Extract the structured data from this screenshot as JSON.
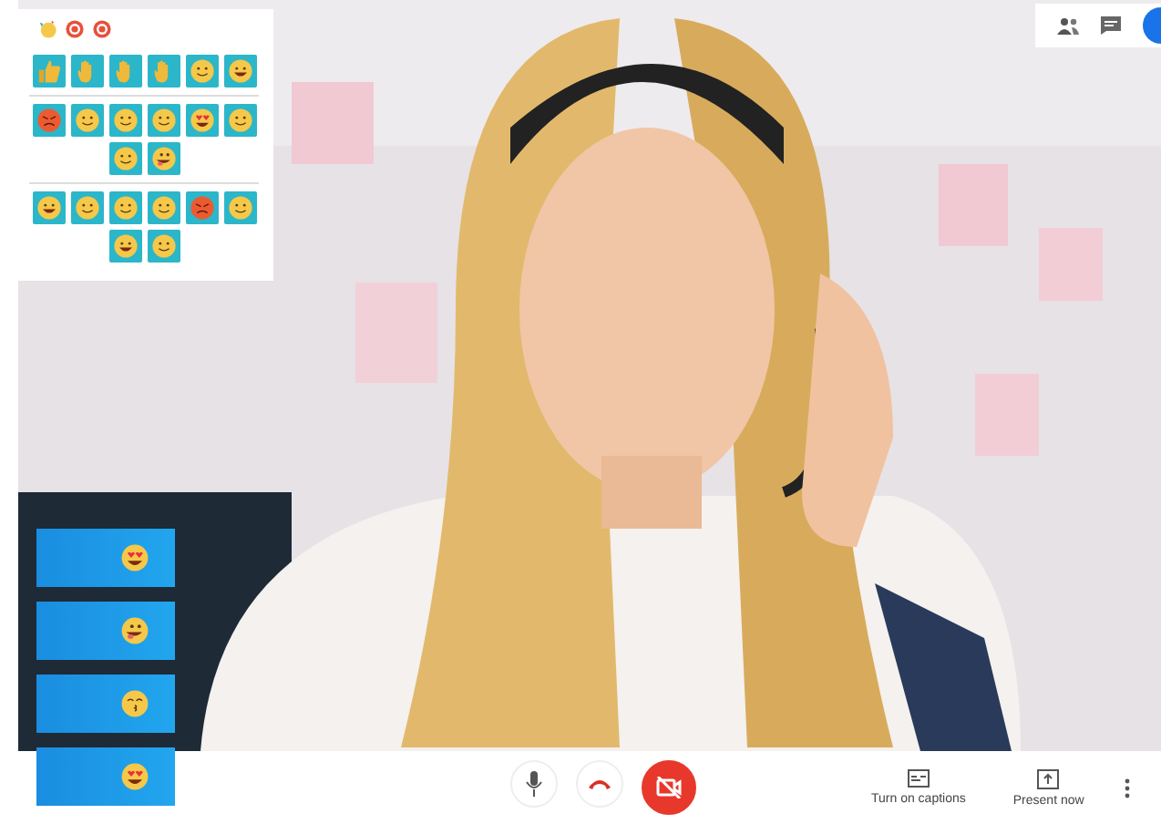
{
  "emoji_panel": {
    "header": [
      {
        "kind": "party"
      },
      {
        "kind": "ring"
      },
      {
        "kind": "ring"
      }
    ],
    "groups": [
      {
        "tiles": [
          {
            "kind": "thumb"
          },
          {
            "kind": "hand"
          },
          {
            "kind": "hand"
          },
          {
            "kind": "hand"
          },
          {
            "kind": "smile"
          },
          {
            "kind": "grin"
          }
        ]
      },
      {
        "tiles": [
          {
            "kind": "angry"
          },
          {
            "kind": "smile"
          },
          {
            "kind": "smile"
          },
          {
            "kind": "smile"
          },
          {
            "kind": "hearts"
          },
          {
            "kind": "smile"
          },
          {
            "kind": "smile"
          },
          {
            "kind": "tongue"
          }
        ]
      },
      {
        "tiles": [
          {
            "kind": "grin"
          },
          {
            "kind": "smile"
          },
          {
            "kind": "smile"
          },
          {
            "kind": "smile"
          },
          {
            "kind": "angry"
          },
          {
            "kind": "smile"
          },
          {
            "kind": "grin"
          },
          {
            "kind": "smile"
          }
        ]
      }
    ]
  },
  "top_controls": [
    {
      "kind": "people"
    },
    {
      "kind": "chat"
    },
    {
      "kind": "avatar"
    }
  ],
  "reactions": [
    {
      "kind": "hearts"
    },
    {
      "kind": "tongue"
    },
    {
      "kind": "kiss"
    },
    {
      "kind": "hearts"
    }
  ],
  "call_controls": [
    {
      "kind": "mic"
    },
    {
      "kind": "hangup"
    },
    {
      "kind": "camera-off"
    }
  ],
  "actions": [
    {
      "kind": "captions",
      "label": "Turn on captions"
    },
    {
      "kind": "present",
      "label": "Present now"
    }
  ]
}
